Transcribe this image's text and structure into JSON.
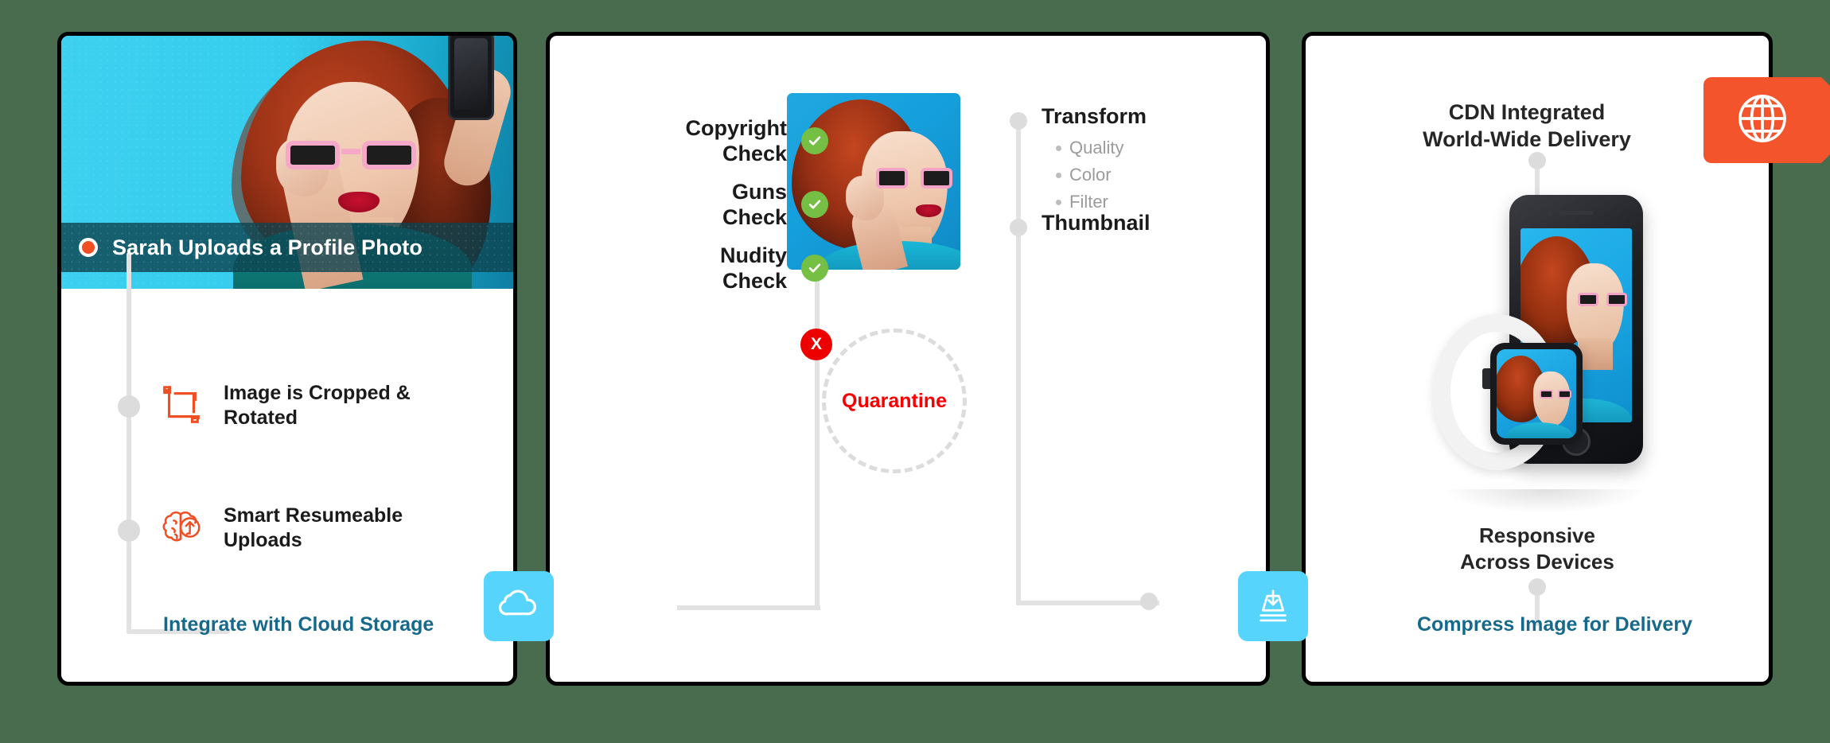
{
  "background_color": "#4a6c4e",
  "accent_colors": {
    "orange": "#f04e23",
    "teal_text": "#16698a",
    "green_check": "#74bf44",
    "red": "#ed0000",
    "light_blue_badge": "#56d4fb",
    "cdn_orange": "#f4542b"
  },
  "left_panel": {
    "caption": "Sarah Uploads a Profile Photo",
    "caption_marker_icon": "record-dot-icon",
    "items": [
      {
        "icon": "crop-rotate-icon",
        "label": "Image is Cropped &\nRotated"
      },
      {
        "icon": "brain-upload-icon",
        "label": "Smart Resumeable\nUploads"
      }
    ],
    "footer_label": "Integrate with Cloud Storage",
    "badge_icon": "cloud-icon"
  },
  "middle_panel": {
    "checks": [
      {
        "label": "Copyright\nCheck",
        "status_icon": "check-circle-icon"
      },
      {
        "label": "Guns\nCheck",
        "status_icon": "check-circle-icon"
      },
      {
        "label": "Nudity\nCheck",
        "status_icon": "check-circle-icon"
      }
    ],
    "preview_image_alt": "profile-photo-preview",
    "quarantine": {
      "label": "Quarantine",
      "badge_icon": "x-circle-icon",
      "badge_label": "X"
    },
    "transform": {
      "title": "Transform",
      "options": [
        "Quality",
        "Color",
        "Filter"
      ]
    },
    "thumbnail_title": "Thumbnail"
  },
  "right_panel": {
    "title": "CDN Integrated\nWorld-Wide Delivery",
    "badge_icon": "globe-icon",
    "devices_alt": "responsive-devices-illustration",
    "responsive_label": "Responsive\nAcross Devices",
    "footer_label": "Compress Image for Delivery",
    "badge_compress_icon": "compress-download-icon"
  }
}
